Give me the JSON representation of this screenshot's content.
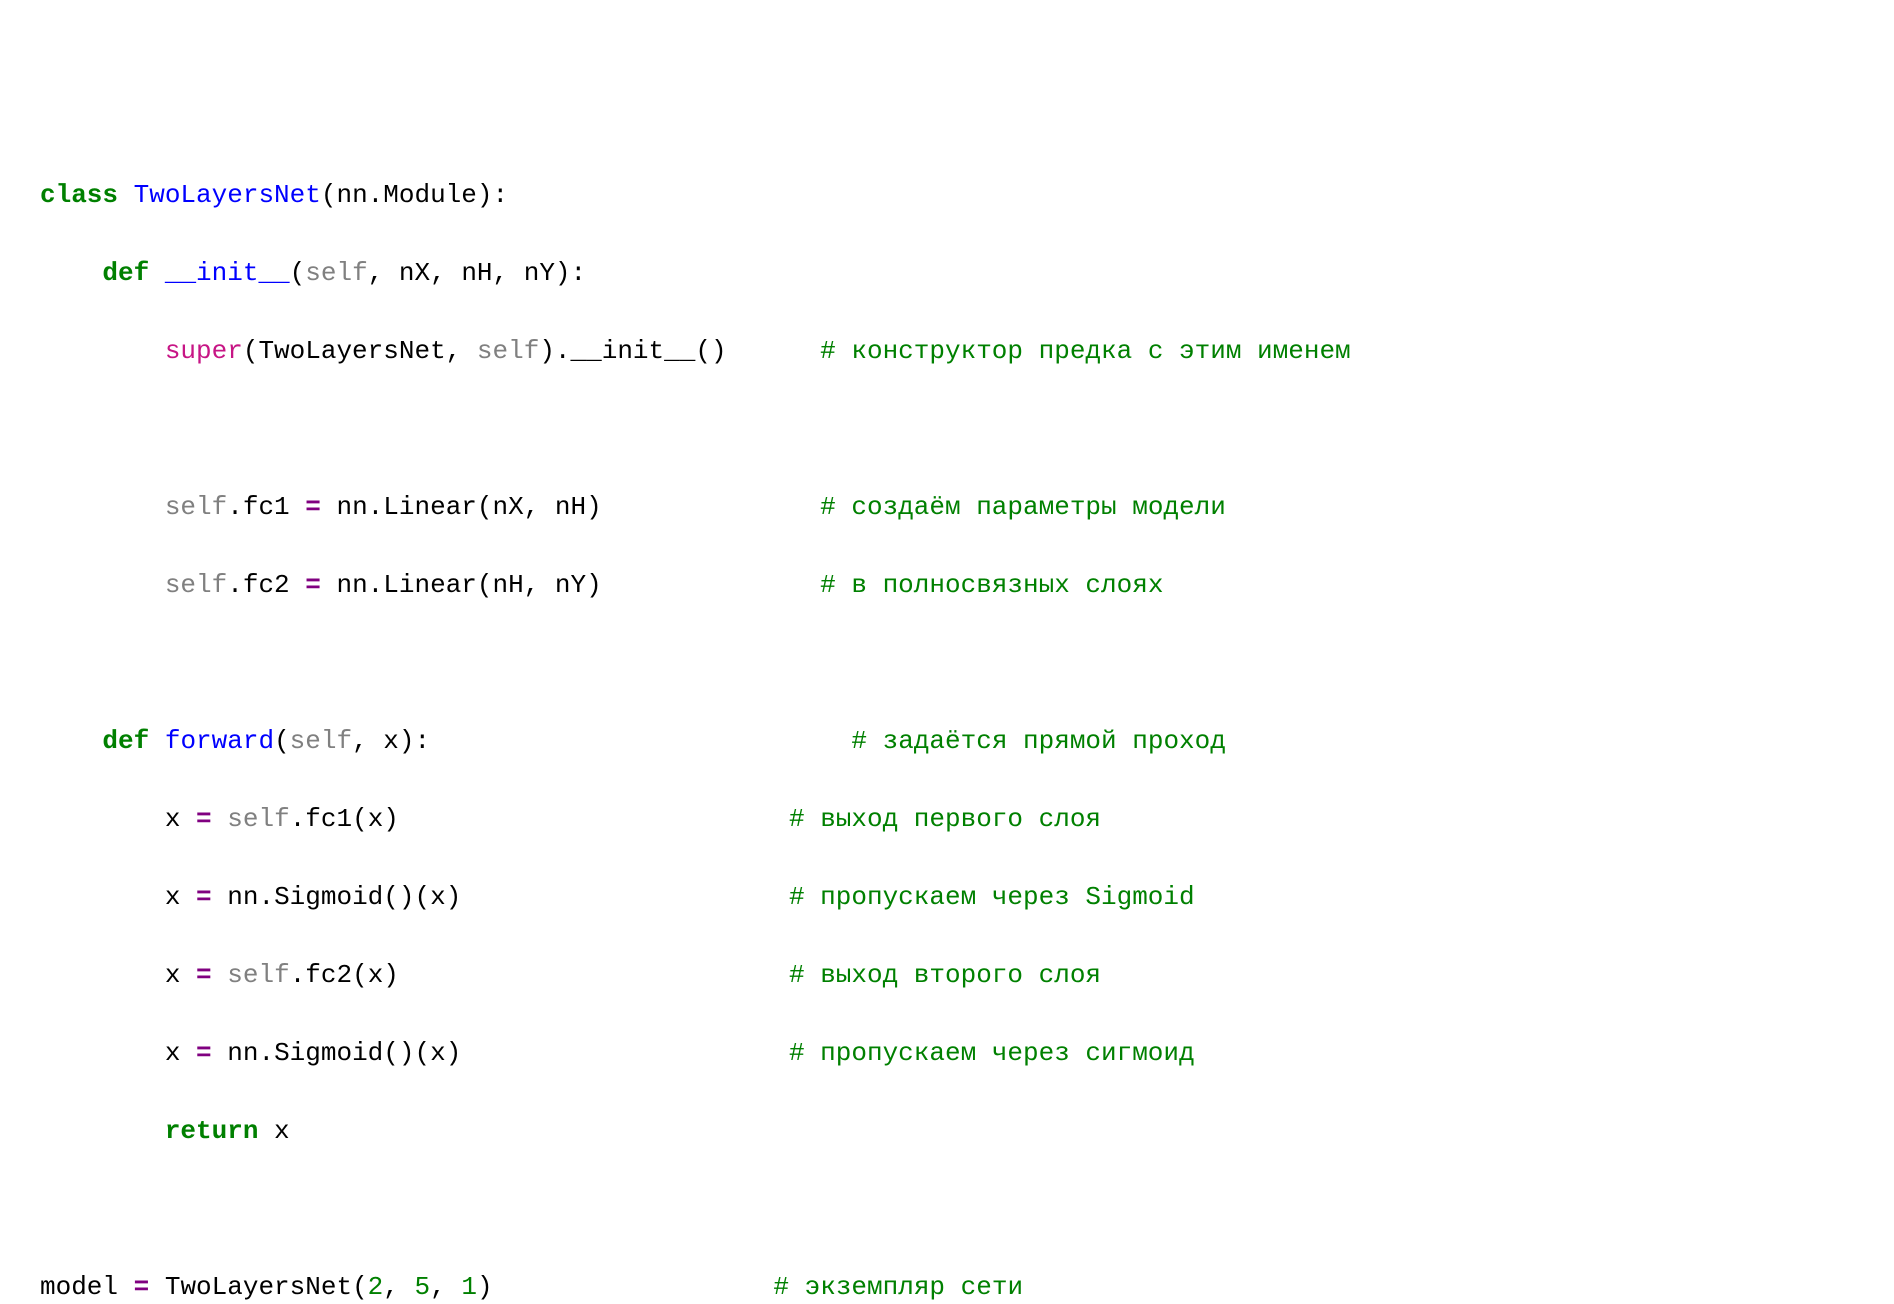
{
  "line1": {
    "kw_class": "class",
    "sp1": " ",
    "name": "TwoLayersNet",
    "rest": "(nn.Module):"
  },
  "line2": {
    "indent": "    ",
    "kw_def": "def",
    "sp1": " ",
    "name": "__init__",
    "paren_open": "(",
    "self": "self",
    "params": ", nX, nH, nY):"
  },
  "line3": {
    "indent": "        ",
    "super": "super",
    "part1": "(TwoLayersNet, ",
    "self": "self",
    "part2": ").__init__()",
    "pad": "      ",
    "comment": "# конструктор предка с этим именем"
  },
  "line4": {
    "blank": " "
  },
  "line5": {
    "indent": "        ",
    "self": "self",
    "part1": ".fc1 ",
    "op": "=",
    "part2": " nn.Linear(nX, nH)",
    "pad": "              ",
    "comment": "# создаём параметры модели"
  },
  "line6": {
    "indent": "        ",
    "self": "self",
    "part1": ".fc2 ",
    "op": "=",
    "part2": " nn.Linear(nH, nY)",
    "pad": "              ",
    "comment": "# в полносвязных слоях"
  },
  "line7": {
    "blank": " "
  },
  "line8": {
    "indent": "    ",
    "kw_def": "def",
    "sp1": " ",
    "name": "forward",
    "paren_open": "(",
    "self": "self",
    "params": ", x):",
    "pad": "                           ",
    "comment": "# задаётся прямой проход"
  },
  "line9": {
    "indent": "        ",
    "var": "x ",
    "op": "=",
    "sp": " ",
    "self": "self",
    "part2": ".fc1(x)",
    "pad": "                         ",
    "comment": "# выход первого слоя"
  },
  "line10": {
    "indent": "        ",
    "var": "x ",
    "op": "=",
    "part2": " nn.Sigmoid()(x)",
    "pad": "                     ",
    "comment": "# пропускаем через Sigmoid"
  },
  "line11": {
    "indent": "        ",
    "var": "x ",
    "op": "=",
    "sp": " ",
    "self": "self",
    "part2": ".fc2(x)",
    "pad": "                         ",
    "comment": "# выход второго слоя"
  },
  "line12": {
    "indent": "        ",
    "var": "x ",
    "op": "=",
    "part2": " nn.Sigmoid()(x)",
    "pad": "                     ",
    "comment": "# пропускаем через сигмоид"
  },
  "line13": {
    "indent": "        ",
    "kw_return": "return",
    "rest": " x"
  },
  "line14": {
    "blank": " "
  },
  "line15": {
    "part1": "model ",
    "op": "=",
    "part2": " TwoLayersNet(",
    "n1": "2",
    "c1": ", ",
    "n2": "5",
    "c2": ", ",
    "n3": "1",
    "part3": ")",
    "pad": "                  ",
    "comment": "# экземпляр сети"
  }
}
